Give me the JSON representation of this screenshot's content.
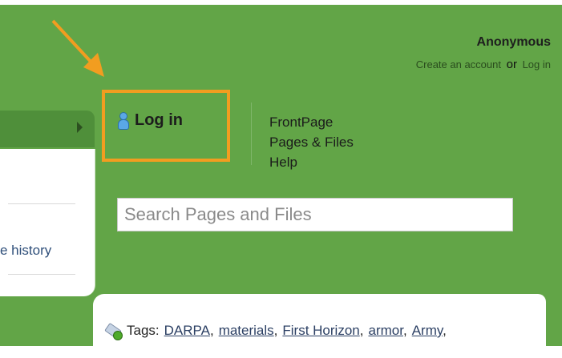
{
  "user": {
    "name": "Anonymous",
    "create_account_label": "Create an account",
    "or_label": "or",
    "login_link_label": "Log in"
  },
  "login_button": {
    "label": "Log in",
    "icon": "person-icon"
  },
  "nav": {
    "items": [
      {
        "label": "FrontPage"
      },
      {
        "label": "Pages & Files"
      },
      {
        "label": "Help"
      }
    ]
  },
  "search": {
    "placeholder": "Search Pages and Files",
    "value": ""
  },
  "left": {
    "history_label": "e history"
  },
  "tags": {
    "label": "Tags:",
    "icon": "tag-add-icon",
    "items": [
      "DARPA",
      "materials",
      "First Horizon",
      "armor",
      "Army"
    ]
  },
  "colors": {
    "background_green": "#62a547",
    "highlight_orange": "#f29d20"
  }
}
